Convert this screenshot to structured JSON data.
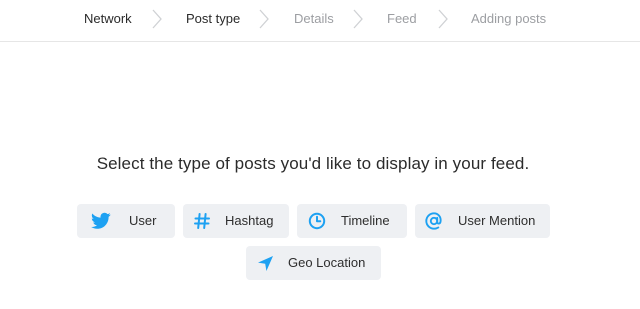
{
  "steps": [
    {
      "label": "Network",
      "state": "done"
    },
    {
      "label": "Post type",
      "state": "current"
    },
    {
      "label": "Details",
      "state": "upcoming"
    },
    {
      "label": "Feed",
      "state": "upcoming"
    },
    {
      "label": "Adding posts",
      "state": "upcoming"
    }
  ],
  "prompt": "Select the type of posts you'd like to display in your feed.",
  "options": [
    {
      "label": "User",
      "icon": "twitter-bird-icon"
    },
    {
      "label": "Hashtag",
      "icon": "hashtag-icon"
    },
    {
      "label": "Timeline",
      "icon": "clock-icon"
    },
    {
      "label": "User Mention",
      "icon": "at-sign-icon"
    },
    {
      "label": "Geo Location",
      "icon": "location-arrow-icon"
    }
  ],
  "colors": {
    "accent": "#1da1f2",
    "step_active": "#2a2a2a",
    "step_inactive": "#9c9ea2",
    "option_bg": "#eef0f3"
  }
}
